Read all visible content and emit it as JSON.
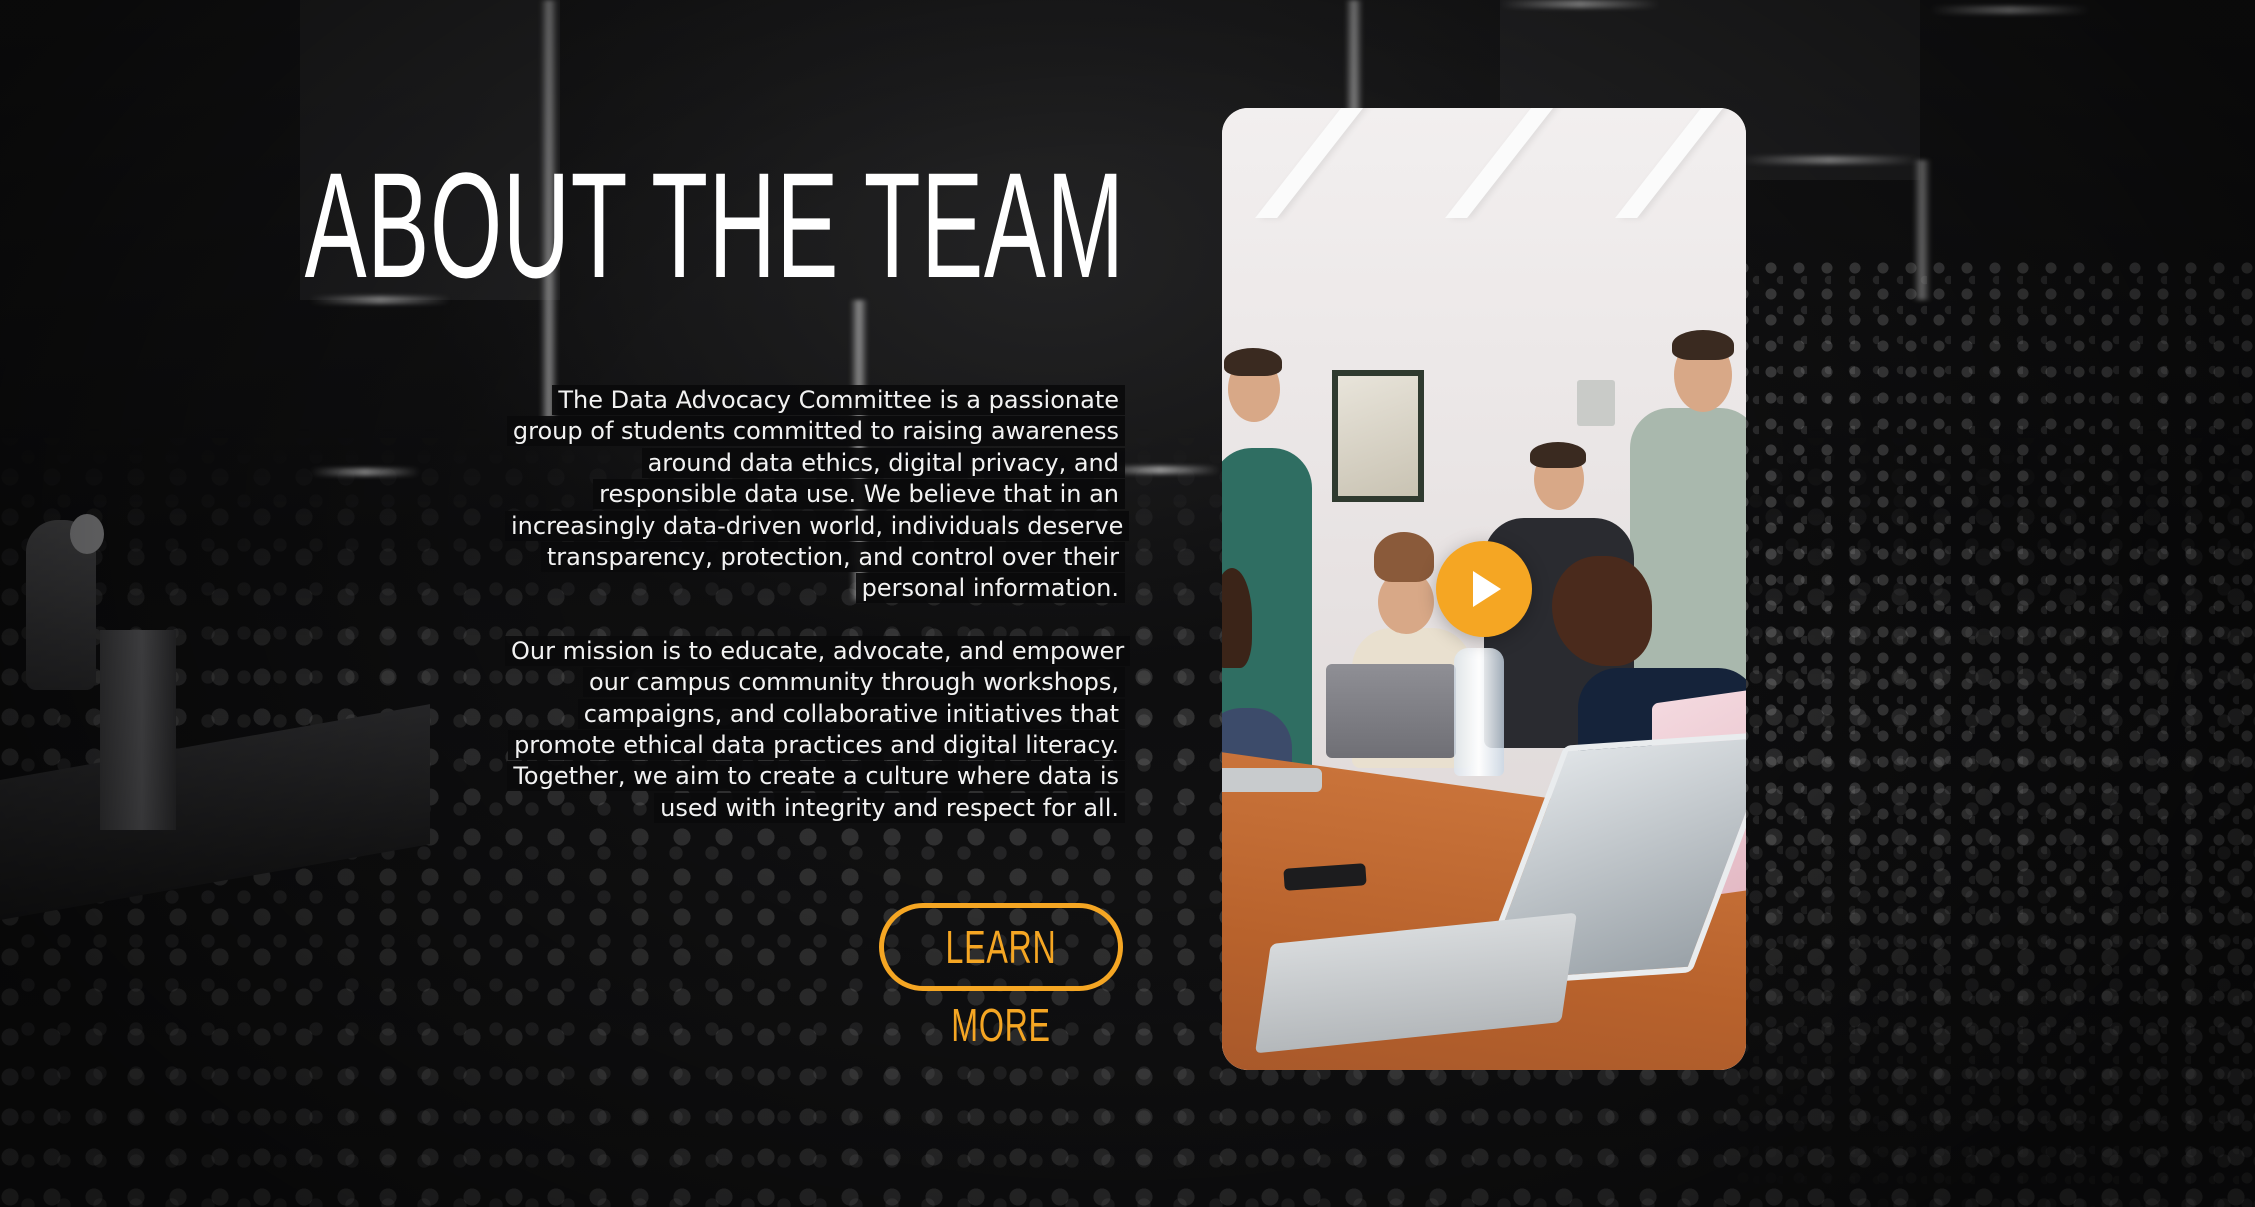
{
  "section": {
    "title": "ABOUT THE TEAM",
    "paragraphs": [
      "The Data Advocacy Committee is a passionate group of students committed to raising awareness around data ethics, digital privacy, and responsible data use. We believe that in an increasingly data-driven world, individuals deserve transparency, protection, and control over their personal information.",
      "Our mission is to educate, advocate, and empower our campus community through workshops, campaigns, and collaborative initiatives that promote ethical data practices and digital literacy. Together, we aim to create a culture where data is used with integrity and respect for all."
    ],
    "cta_label": "LEARN MORE"
  },
  "video": {
    "play_icon": "play-icon"
  },
  "colors": {
    "accent": "#f5a623",
    "background": "#0a0a0b",
    "text": "#ffffff"
  }
}
